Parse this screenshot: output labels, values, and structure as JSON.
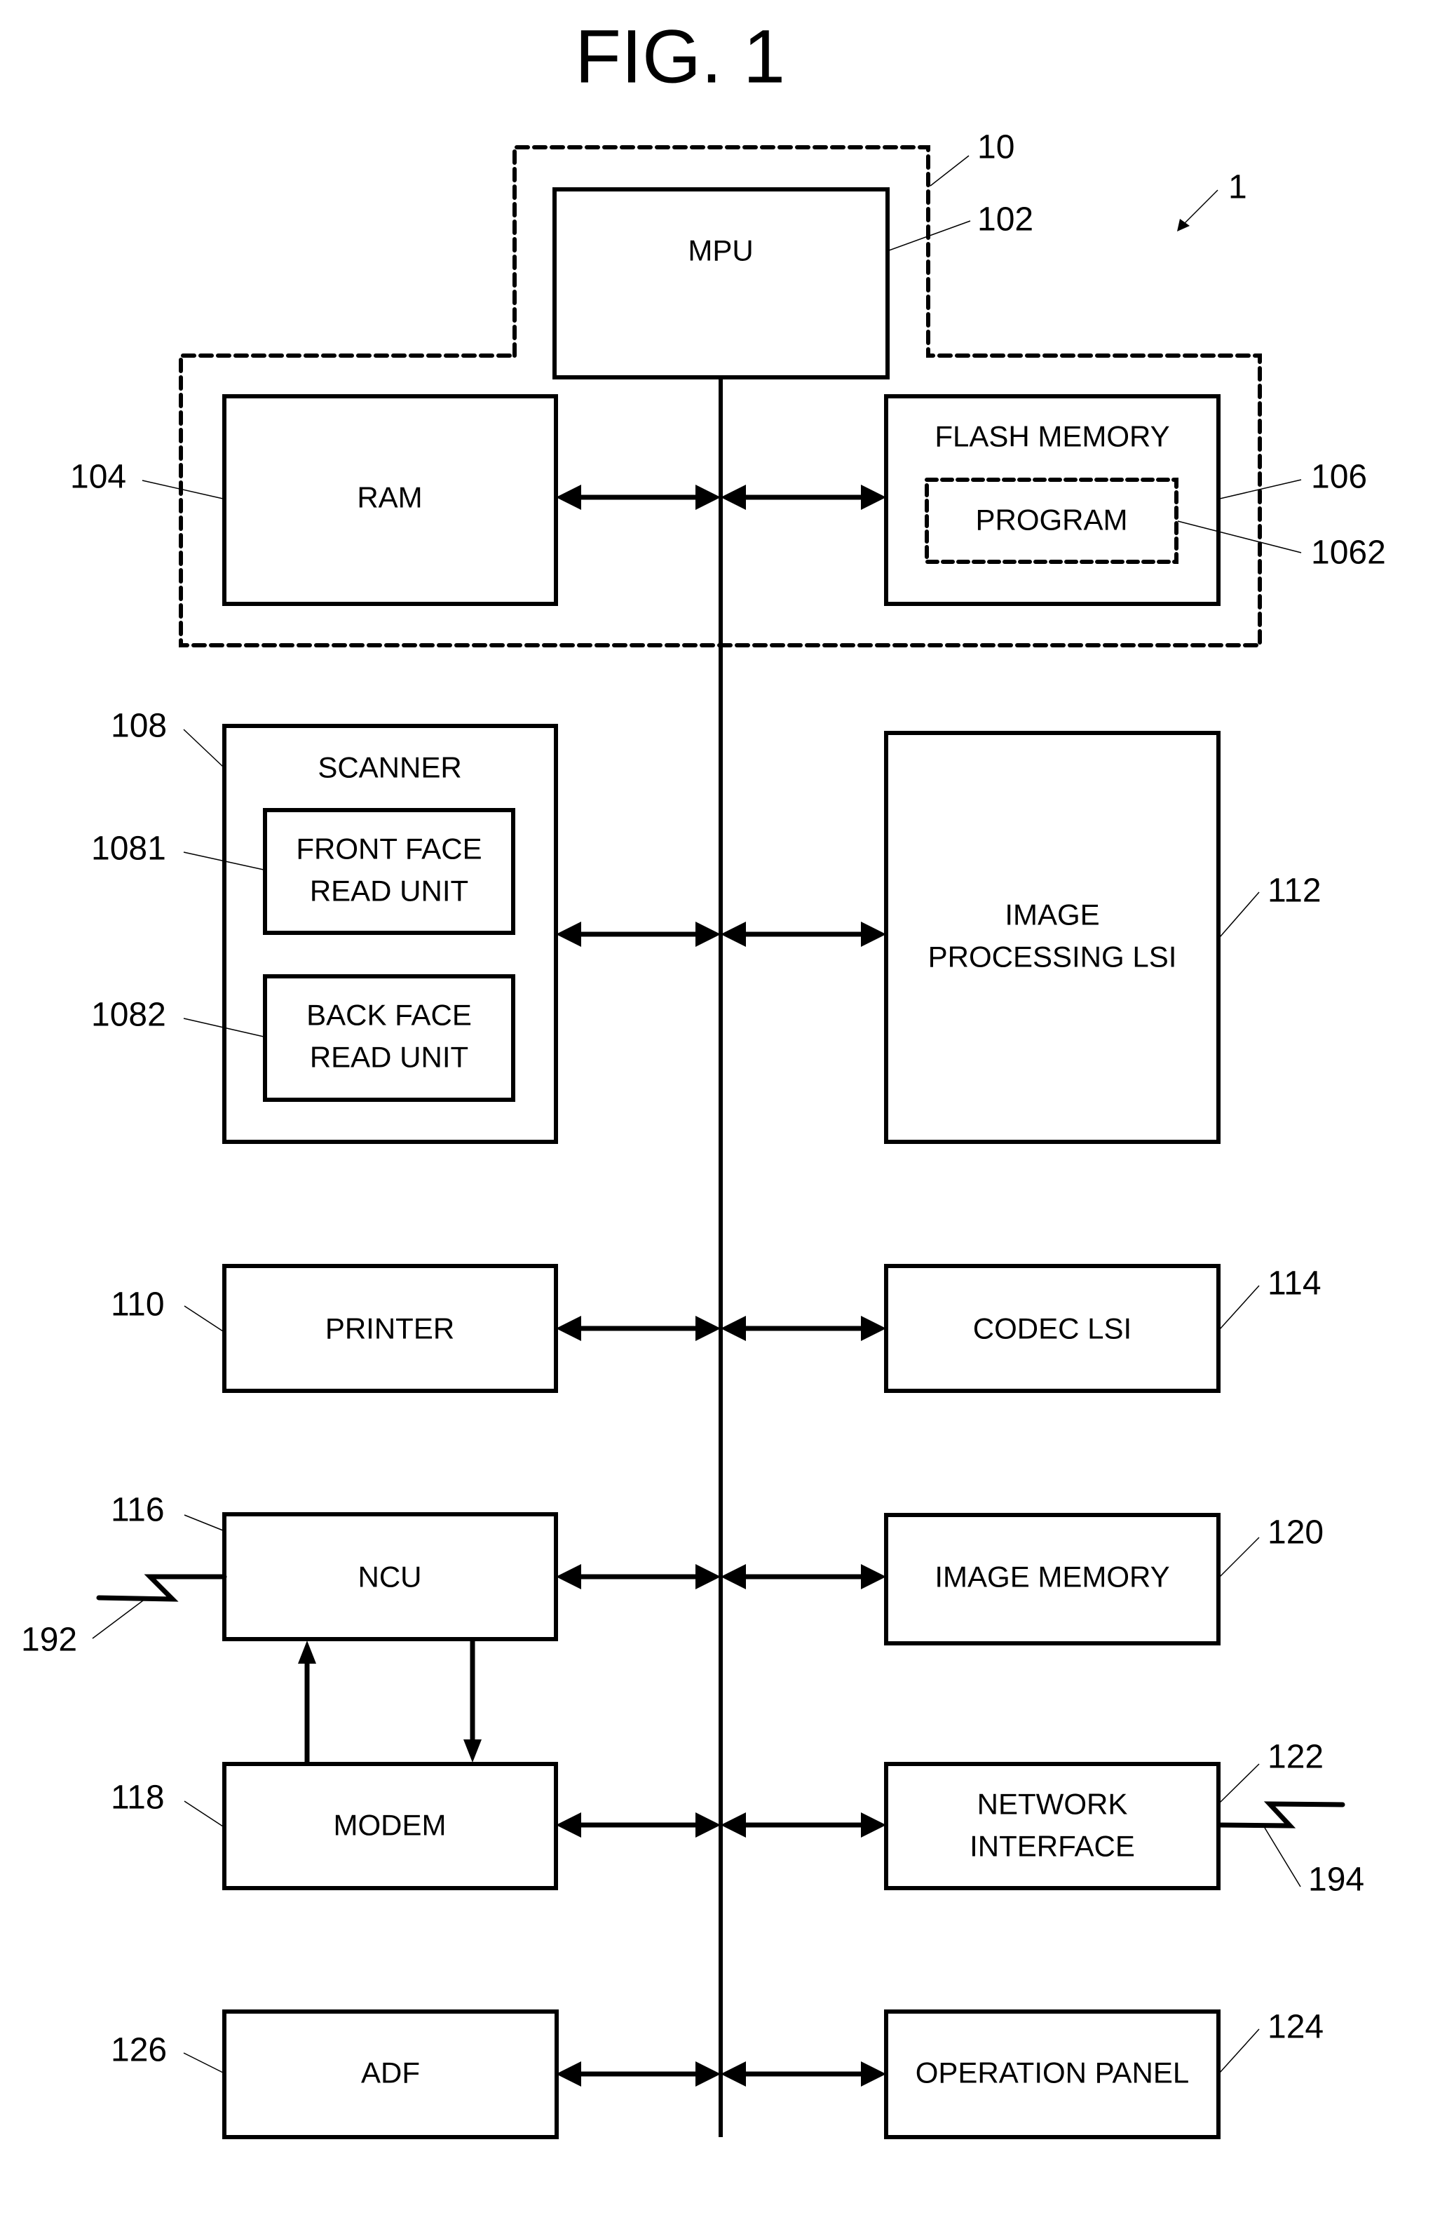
{
  "figure": {
    "title": "FIG. 1",
    "system_ref": "1"
  },
  "control_group": {
    "ref": "10"
  },
  "blocks": {
    "mpu": {
      "label": "MPU",
      "ref": "102"
    },
    "ram": {
      "label": "RAM",
      "ref": "104"
    },
    "flash_memory": {
      "label": "FLASH MEMORY",
      "ref": "106"
    },
    "program": {
      "label": "PROGRAM",
      "ref": "1062"
    },
    "scanner": {
      "label": "SCANNER",
      "ref": "108"
    },
    "front_face_read_unit": {
      "label_line1": "FRONT FACE",
      "label_line2": "READ UNIT",
      "ref": "1081"
    },
    "back_face_read_unit": {
      "label_line1": "BACK FACE",
      "label_line2": "READ UNIT",
      "ref": "1082"
    },
    "image_processing_lsi": {
      "label_line1": "IMAGE",
      "label_line2": "PROCESSING LSI",
      "ref": "112"
    },
    "printer": {
      "label": "PRINTER",
      "ref": "110"
    },
    "codec_lsi": {
      "label": "CODEC LSI",
      "ref": "114"
    },
    "ncu": {
      "label": "NCU",
      "ref": "116"
    },
    "image_memory": {
      "label": "IMAGE MEMORY",
      "ref": "120"
    },
    "modem": {
      "label": "MODEM",
      "ref": "118"
    },
    "network_interface": {
      "label_line1": "NETWORK",
      "label_line2": "INTERFACE",
      "ref": "122"
    },
    "adf": {
      "label": "ADF",
      "ref": "126"
    },
    "operation_panel": {
      "label": "OPERATION PANEL",
      "ref": "124"
    }
  },
  "external_lines": {
    "telephone_line": {
      "ref": "192"
    },
    "network_line": {
      "ref": "194"
    }
  },
  "connections": [
    {
      "from": "mpu",
      "to": "bus",
      "type": "line"
    },
    {
      "from": "ram",
      "to": "bus",
      "type": "bidirectional"
    },
    {
      "from": "flash_memory",
      "to": "bus",
      "type": "bidirectional"
    },
    {
      "from": "scanner",
      "to": "bus",
      "type": "bidirectional"
    },
    {
      "from": "image_processing_lsi",
      "to": "bus",
      "type": "bidirectional"
    },
    {
      "from": "printer",
      "to": "bus",
      "type": "bidirectional"
    },
    {
      "from": "codec_lsi",
      "to": "bus",
      "type": "bidirectional"
    },
    {
      "from": "ncu",
      "to": "bus",
      "type": "bidirectional"
    },
    {
      "from": "image_memory",
      "to": "bus",
      "type": "bidirectional"
    },
    {
      "from": "modem",
      "to": "bus",
      "type": "bidirectional"
    },
    {
      "from": "network_interface",
      "to": "bus",
      "type": "bidirectional"
    },
    {
      "from": "adf",
      "to": "bus",
      "type": "bidirectional"
    },
    {
      "from": "operation_panel",
      "to": "bus",
      "type": "bidirectional"
    },
    {
      "from": "modem",
      "to": "ncu",
      "type": "directed"
    },
    {
      "from": "ncu",
      "to": "modem",
      "type": "directed"
    }
  ]
}
